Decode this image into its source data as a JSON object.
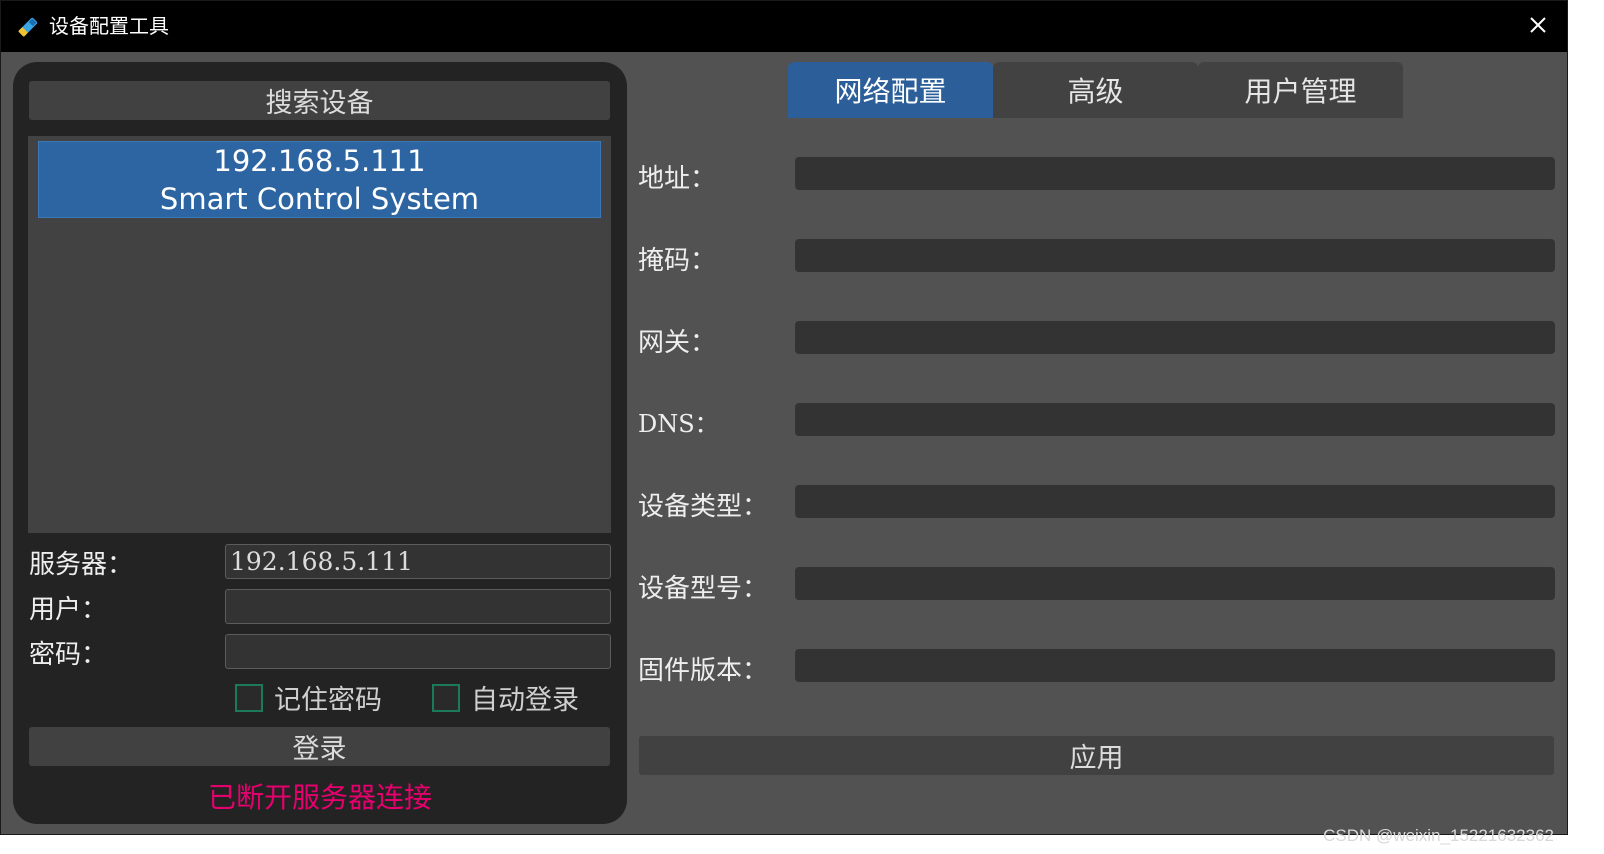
{
  "window": {
    "title": "设备配置工具",
    "app_icon": "wrench-icon",
    "close_icon": "close-icon"
  },
  "left": {
    "search_button": "搜索设备",
    "devices": [
      {
        "ip": "192.168.5.111",
        "name": "Smart Control System"
      }
    ],
    "server_label": "服务器：",
    "server_value": "192.168.5.111",
    "user_label": "用户：",
    "user_value": "",
    "password_label": "密码：",
    "password_value": "",
    "remember_password": "记住密码",
    "auto_login": "自动登录",
    "login_button": "登录",
    "status": "已断开服务器连接",
    "status_color": "#e6006e"
  },
  "tabs": [
    {
      "label": "网络配置",
      "active": true
    },
    {
      "label": "高级",
      "active": false
    },
    {
      "label": "用户管理",
      "active": false
    }
  ],
  "network": {
    "fields": [
      {
        "label": "地址：",
        "value": ""
      },
      {
        "label": "掩码：",
        "value": ""
      },
      {
        "label": "网关：",
        "value": ""
      },
      {
        "label": "DNS：",
        "value": ""
      },
      {
        "label": "设备类型：",
        "value": ""
      },
      {
        "label": "设备型号：",
        "value": ""
      },
      {
        "label": "固件版本：",
        "value": ""
      }
    ],
    "apply_button": "应用"
  },
  "watermark": "CSDN @weixin_15221632362",
  "colors": {
    "accent": "#2c5f99",
    "panel": "#232323",
    "background": "#525252"
  }
}
